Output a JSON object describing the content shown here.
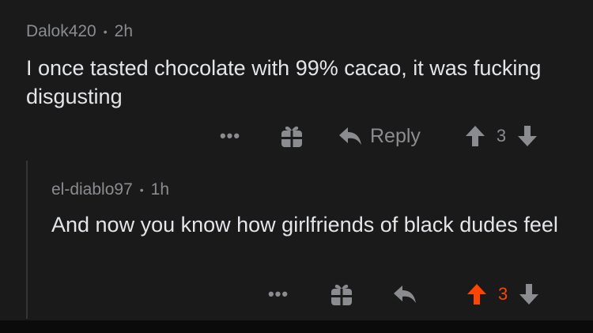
{
  "comments": [
    {
      "author": "Dalok420",
      "separator": "•",
      "age": "2h",
      "text": "I once tasted chocolate with 99% cacao, it was fucking disgusting",
      "actions": {
        "more": "•••",
        "reply_label": "Reply",
        "score": "3",
        "upvoted": false
      }
    },
    {
      "author": "el-diablo97",
      "separator": "•",
      "age": "1h",
      "text": "And now you know how girlfriends of black dudes feel",
      "actions": {
        "more": "•••",
        "score": "3",
        "upvoted": true
      }
    }
  ],
  "colors": {
    "background": "#1a1a1b",
    "text": "#e3e5e8",
    "muted": "#8a8c8f",
    "upvote": "#ff4500"
  },
  "icons": [
    "more-icon",
    "gift-icon",
    "reply-icon",
    "upvote-icon",
    "downvote-icon"
  ]
}
